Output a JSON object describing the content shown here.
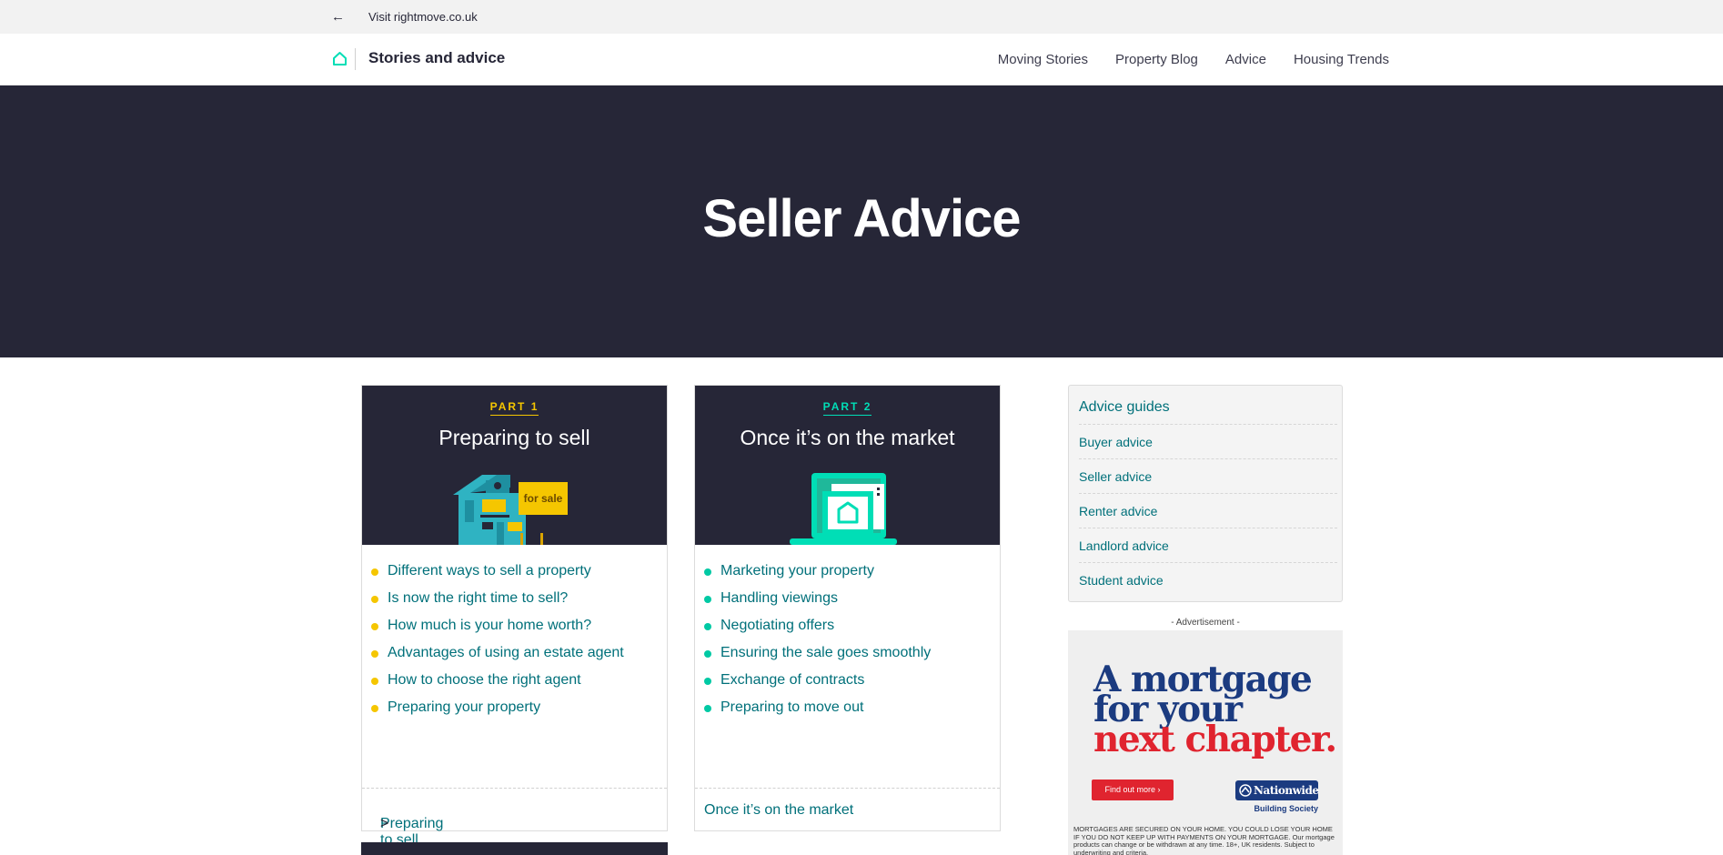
{
  "topbar": {
    "back_arrow": "←",
    "visit_text": "Visit rightmove.co.uk"
  },
  "nav": {
    "site_title": "Stories and advice",
    "links": [
      "Moving Stories",
      "Property Blog",
      "Advice",
      "Housing Trends"
    ]
  },
  "hero": {
    "title": "Seller Advice"
  },
  "colors": {
    "accent_teal": "#00deb6",
    "accent_yellow": "#f5c600",
    "dark_navy": "#262637",
    "link_teal": "#00707a"
  },
  "cards": [
    {
      "part": "PART 1",
      "title": "Preparing to sell",
      "sign_text": "for sale",
      "items": [
        "Different ways to sell a property",
        "Is now the right time to sell?",
        "How much is your home worth?",
        "Advantages of using an estate agent",
        "How to choose the right agent",
        "Preparing your property"
      ],
      "footer": "Preparing to sell",
      "footer_arrow": ">"
    },
    {
      "part": "PART 2",
      "title": "Once it’s on the market",
      "items": [
        "Marketing your property",
        "Handling viewings",
        "Negotiating offers",
        "Ensuring the sale goes smoothly",
        "Exchange of contracts",
        "Preparing to move out"
      ],
      "footer": "Once it’s on the market"
    }
  ],
  "sidebar": {
    "heading": "Advice guides",
    "items": [
      "Buyer advice",
      "Seller advice",
      "Renter advice",
      "Landlord advice",
      "Student advice"
    ]
  },
  "ad": {
    "label": "- Advertisement -",
    "line1": "A mortgage",
    "line2": "for your",
    "line3": "next chapter.",
    "cta": "Find out more",
    "brand": "Nationwide",
    "brand_sub": "Building Society",
    "fine_print": "MORTGAGES ARE SECURED ON YOUR HOME. YOU COULD LOSE YOUR HOME IF YOU DO NOT KEEP UP WITH PAYMENTS ON YOUR MORTGAGE. Our mortgage products can change or be withdrawn at any time. 18+, UK residents. Subject to underwriting and criteria."
  }
}
